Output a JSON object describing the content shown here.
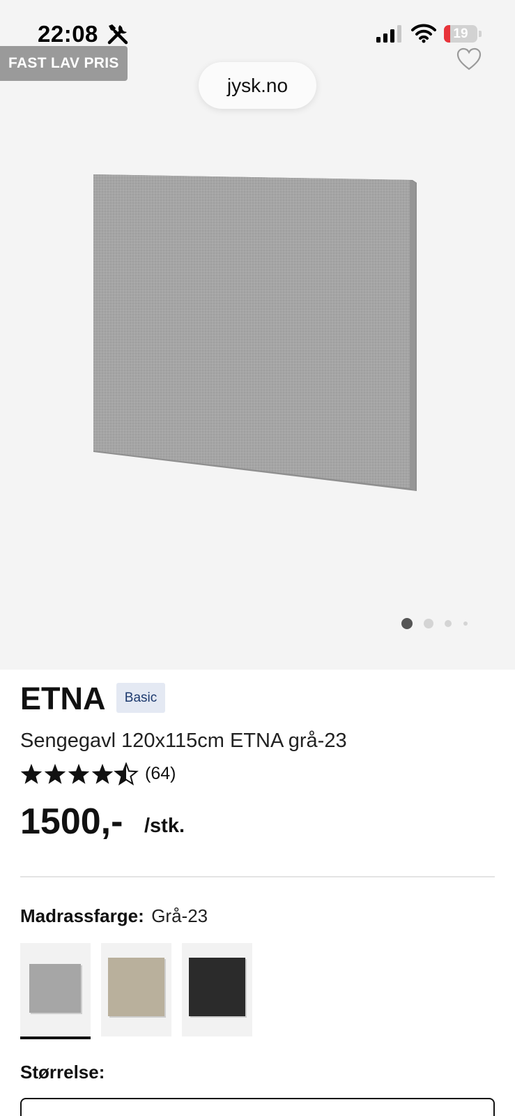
{
  "status_bar": {
    "time": "22:08",
    "battery_level": "19",
    "battery_fraction": 0.19,
    "icons": [
      "tools-icon",
      "cellular-signal-icon",
      "wifi-icon",
      "battery-icon"
    ]
  },
  "browser": {
    "url": "jysk.no"
  },
  "hero": {
    "badge": "FAST LAV PRIS",
    "favorite_icon": "heart-outline-icon",
    "image_count": 4,
    "active_image_index": 0,
    "colors": {
      "background": "#f4f4f4",
      "product": "#a3a3a3",
      "badge": "#9a9a9a"
    }
  },
  "product": {
    "name": "ETNA",
    "tag": "Basic",
    "description": "Sengegavl 120x115cm ETNA grå-23",
    "rating": 4.5,
    "rating_max": 5,
    "rating_count": "(64)",
    "price": "1500,-",
    "unit": "/stk."
  },
  "color_picker": {
    "label": "Madrassfarge:",
    "selected_value": "Grå-23",
    "options": [
      {
        "name": "grey",
        "color": "#a6a6a6",
        "selected": true
      },
      {
        "name": "beige",
        "color": "#b9b09c",
        "selected": false
      },
      {
        "name": "black",
        "color": "#2b2b2b",
        "selected": false
      }
    ]
  },
  "size_picker": {
    "label": "Størrelse:"
  },
  "colors": {
    "tag_bg": "#e4e9f3",
    "tag_text": "#1d3a6e",
    "battery_low": "#e8343a"
  }
}
